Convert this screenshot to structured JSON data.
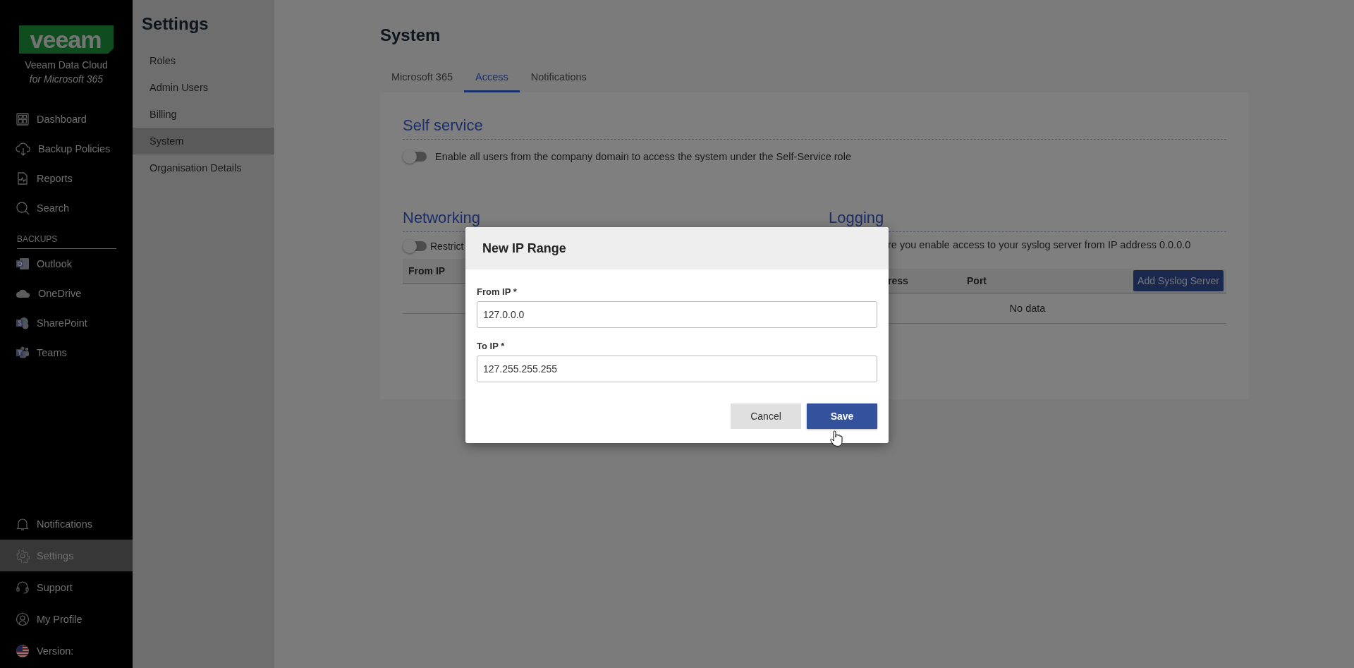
{
  "sidebar": {
    "logo": "veeam",
    "product": "Veeam Data Cloud",
    "subtitle": "for Microsoft 365",
    "nav": [
      {
        "label": "Dashboard",
        "selected": false
      },
      {
        "label": "Backup Policies",
        "selected": false
      },
      {
        "label": "Reports",
        "selected": false
      },
      {
        "label": "Search",
        "selected": false
      }
    ],
    "section_label": "BACKUPS",
    "backups": [
      {
        "label": "Outlook",
        "selected": false
      },
      {
        "label": "OneDrive",
        "selected": false
      },
      {
        "label": "SharePoint",
        "selected": false
      },
      {
        "label": "Teams",
        "selected": false
      }
    ],
    "bottom": [
      {
        "label": "Notifications",
        "selected": false
      },
      {
        "label": "Settings",
        "selected": true
      },
      {
        "label": "Support",
        "selected": false
      },
      {
        "label": "My Profile",
        "selected": false
      },
      {
        "label": "Version:",
        "selected": false
      }
    ]
  },
  "settings_nav": {
    "title": "Settings",
    "items": [
      {
        "label": "Roles",
        "selected": false
      },
      {
        "label": "Admin Users",
        "selected": false
      },
      {
        "label": "Billing",
        "selected": false
      },
      {
        "label": "System",
        "selected": true
      },
      {
        "label": "Organisation Details",
        "selected": false
      }
    ]
  },
  "page": {
    "title": "System",
    "tabs": [
      {
        "label": "Microsoft 365",
        "selected": false
      },
      {
        "label": "Access",
        "selected": true
      },
      {
        "label": "Notifications",
        "selected": false
      }
    ],
    "self_service": {
      "heading": "Self service",
      "toggle": {
        "label": "Enable all users from the company domain to access the system under the Self-Service role",
        "on": false
      }
    },
    "networking": {
      "heading": "Networking",
      "toggle": {
        "label": "Restrict",
        "on": false
      },
      "columns": [
        "From IP"
      ]
    },
    "logging": {
      "heading": "Logging",
      "description": "re you enable access to your syslog server from IP address 0.0.0.0",
      "columns": [
        "ress",
        "Port"
      ],
      "button": "Add Syslog Server",
      "empty_text": "No data"
    }
  },
  "dialog": {
    "title": "New IP Range",
    "fields": [
      {
        "label": "From IP *",
        "value": "127.0.0.0"
      },
      {
        "label": "To IP *",
        "value": "127.255.255.255"
      }
    ],
    "buttons": [
      {
        "label": "Cancel",
        "kind": "secondary"
      },
      {
        "label": "Save",
        "kind": "primary"
      }
    ]
  }
}
